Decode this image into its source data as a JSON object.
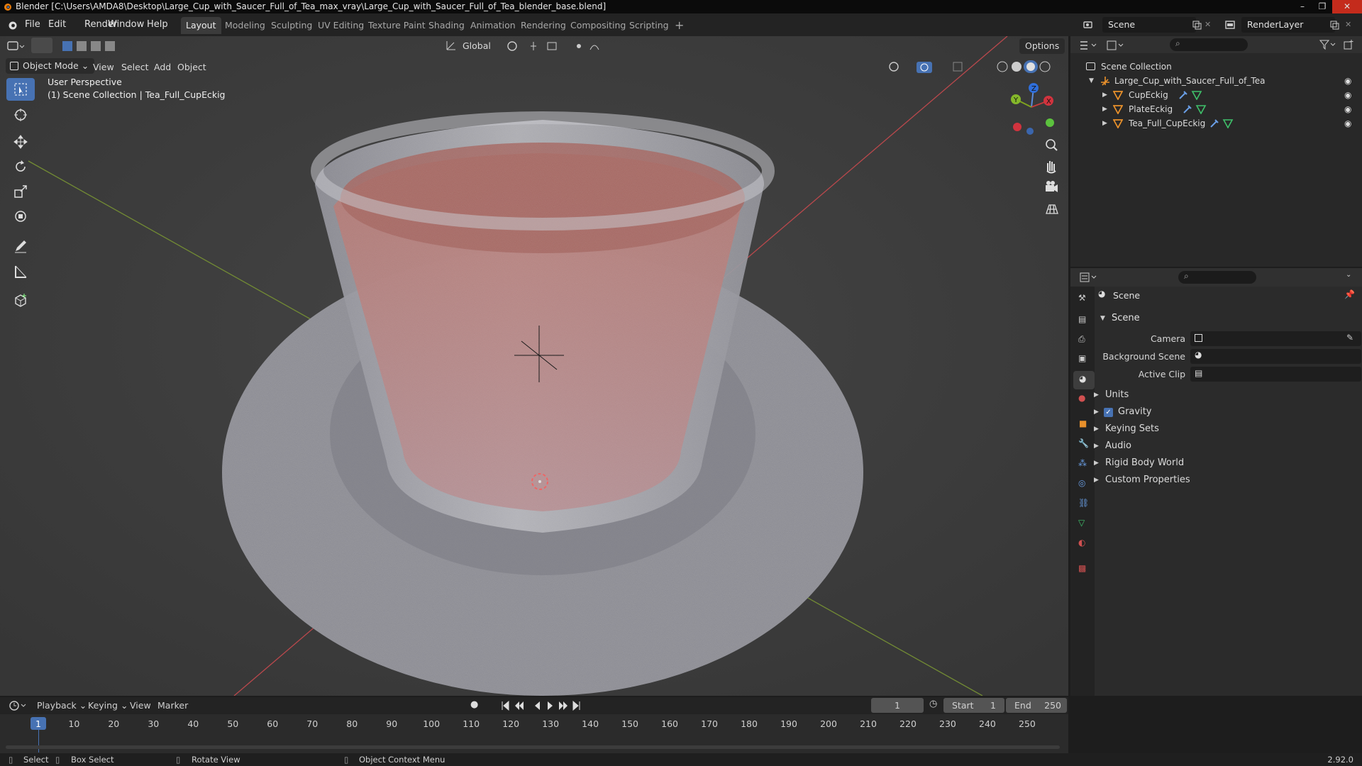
{
  "window": {
    "title": "Blender [C:\\Users\\AMDA8\\Desktop\\Large_Cup_with_Saucer_Full_of_Tea_max_vray\\Large_Cup_with_Saucer_Full_of_Tea_blender_base.blend]",
    "minimize": "–",
    "maximize": "❐",
    "close": "✕"
  },
  "menu": {
    "file": "File",
    "edit": "Edit",
    "render": "Render",
    "window": "Window",
    "help": "Help"
  },
  "workspaces": [
    "Layout",
    "Modeling",
    "Sculpting",
    "UV Editing",
    "Texture Paint",
    "Shading",
    "Animation",
    "Rendering",
    "Compositing",
    "Scripting"
  ],
  "add_workspace": "+",
  "scene_selector": {
    "scene": "Scene",
    "view_layer": "RenderLayer"
  },
  "viewport_header": {
    "mode": "Object Mode",
    "view": "View",
    "select": "Select",
    "add": "Add",
    "object": "Object",
    "transform_orientation": "Global",
    "options": "Options"
  },
  "viewport_overlay": {
    "perspective": "User Perspective",
    "collection_info": "(1) Scene Collection | Tea_Full_CupEckig"
  },
  "gizmo": {
    "x": "X",
    "y": "Y",
    "z": "Z"
  },
  "outliner": {
    "root": "Scene Collection",
    "collection": "Large_Cup_with_Saucer_Full_of_Tea",
    "objects": [
      "CupEckig",
      "PlateEckig",
      "Tea_Full_CupEckig"
    ]
  },
  "properties": {
    "context": "Scene",
    "panel": "Scene",
    "camera_label": "Camera",
    "background_scene_label": "Background Scene",
    "active_clip_label": "Active Clip",
    "subpanels": [
      "Units",
      "Gravity",
      "Keying Sets",
      "Audio",
      "Rigid Body World",
      "Custom Properties"
    ],
    "gravity_enabled": true
  },
  "timeline": {
    "playback": "Playback",
    "keying": "Keying",
    "view": "View",
    "marker": "Marker",
    "current_frame": "1",
    "start_label": "Start",
    "start": "1",
    "end_label": "End",
    "end": "250",
    "ticks": [
      "1",
      "10",
      "20",
      "30",
      "40",
      "50",
      "60",
      "70",
      "80",
      "90",
      "100",
      "110",
      "120",
      "130",
      "140",
      "150",
      "160",
      "170",
      "180",
      "190",
      "200",
      "210",
      "220",
      "230",
      "240",
      "250"
    ]
  },
  "statusbar": {
    "select": "Select",
    "box_select": "Box Select",
    "rotate_view": "Rotate View",
    "context_menu": "Object Context Menu",
    "version": "2.92.0"
  },
  "colors": {
    "accent": "#4772b3",
    "x_axis": "#c43c3c",
    "y_axis": "#7a9a2a",
    "tea": "#c46a5c"
  }
}
